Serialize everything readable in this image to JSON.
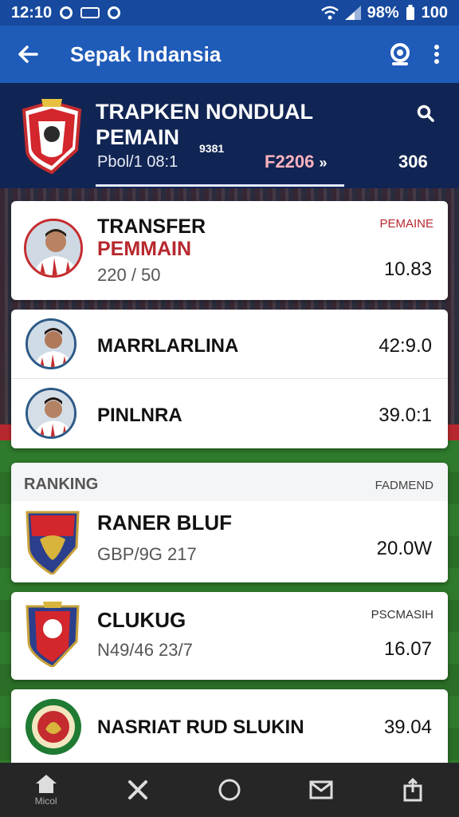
{
  "statusbar": {
    "time": "12:10",
    "battery": "98%",
    "signal_value": "100"
  },
  "appbar": {
    "title": "Sepak Indansia"
  },
  "hero": {
    "title": "TRAPKEN NONDUAL PEMAIN",
    "subtitle": "Pbol/1 08:1",
    "mid_text": "9381",
    "code": "F2206",
    "code_arrow": "»",
    "value": "306"
  },
  "transfer_card": {
    "title_line1": "TRANSFER",
    "title_line2": "PEMMAIN",
    "sub": "220 / 50",
    "tag": "PEMAINE",
    "value": "10.83"
  },
  "players": [
    {
      "name": "MARRLARLINA",
      "value": "42:9.0"
    },
    {
      "name": "PINLNRA",
      "value": "39.0:1"
    }
  ],
  "ranking": {
    "label": "RANKING",
    "tag": "FADMEND",
    "clubs": [
      {
        "name": "RANER BLUF",
        "sub": "GBP/9G 217",
        "value": "20.0W",
        "tag": ""
      },
      {
        "name": "CLUKUG",
        "sub": "N49/46 23/7",
        "value": "16.07",
        "tag": "PSCMASIH"
      },
      {
        "name": "NASRIAT RUD SLUKIN",
        "sub": "",
        "value": "39.04",
        "tag": ""
      }
    ]
  },
  "bottomnav": {
    "home_label": "Micol"
  },
  "colors": {
    "primary": "#1f5bb8",
    "header_dark": "#112554",
    "accent_red": "#b7282e"
  }
}
